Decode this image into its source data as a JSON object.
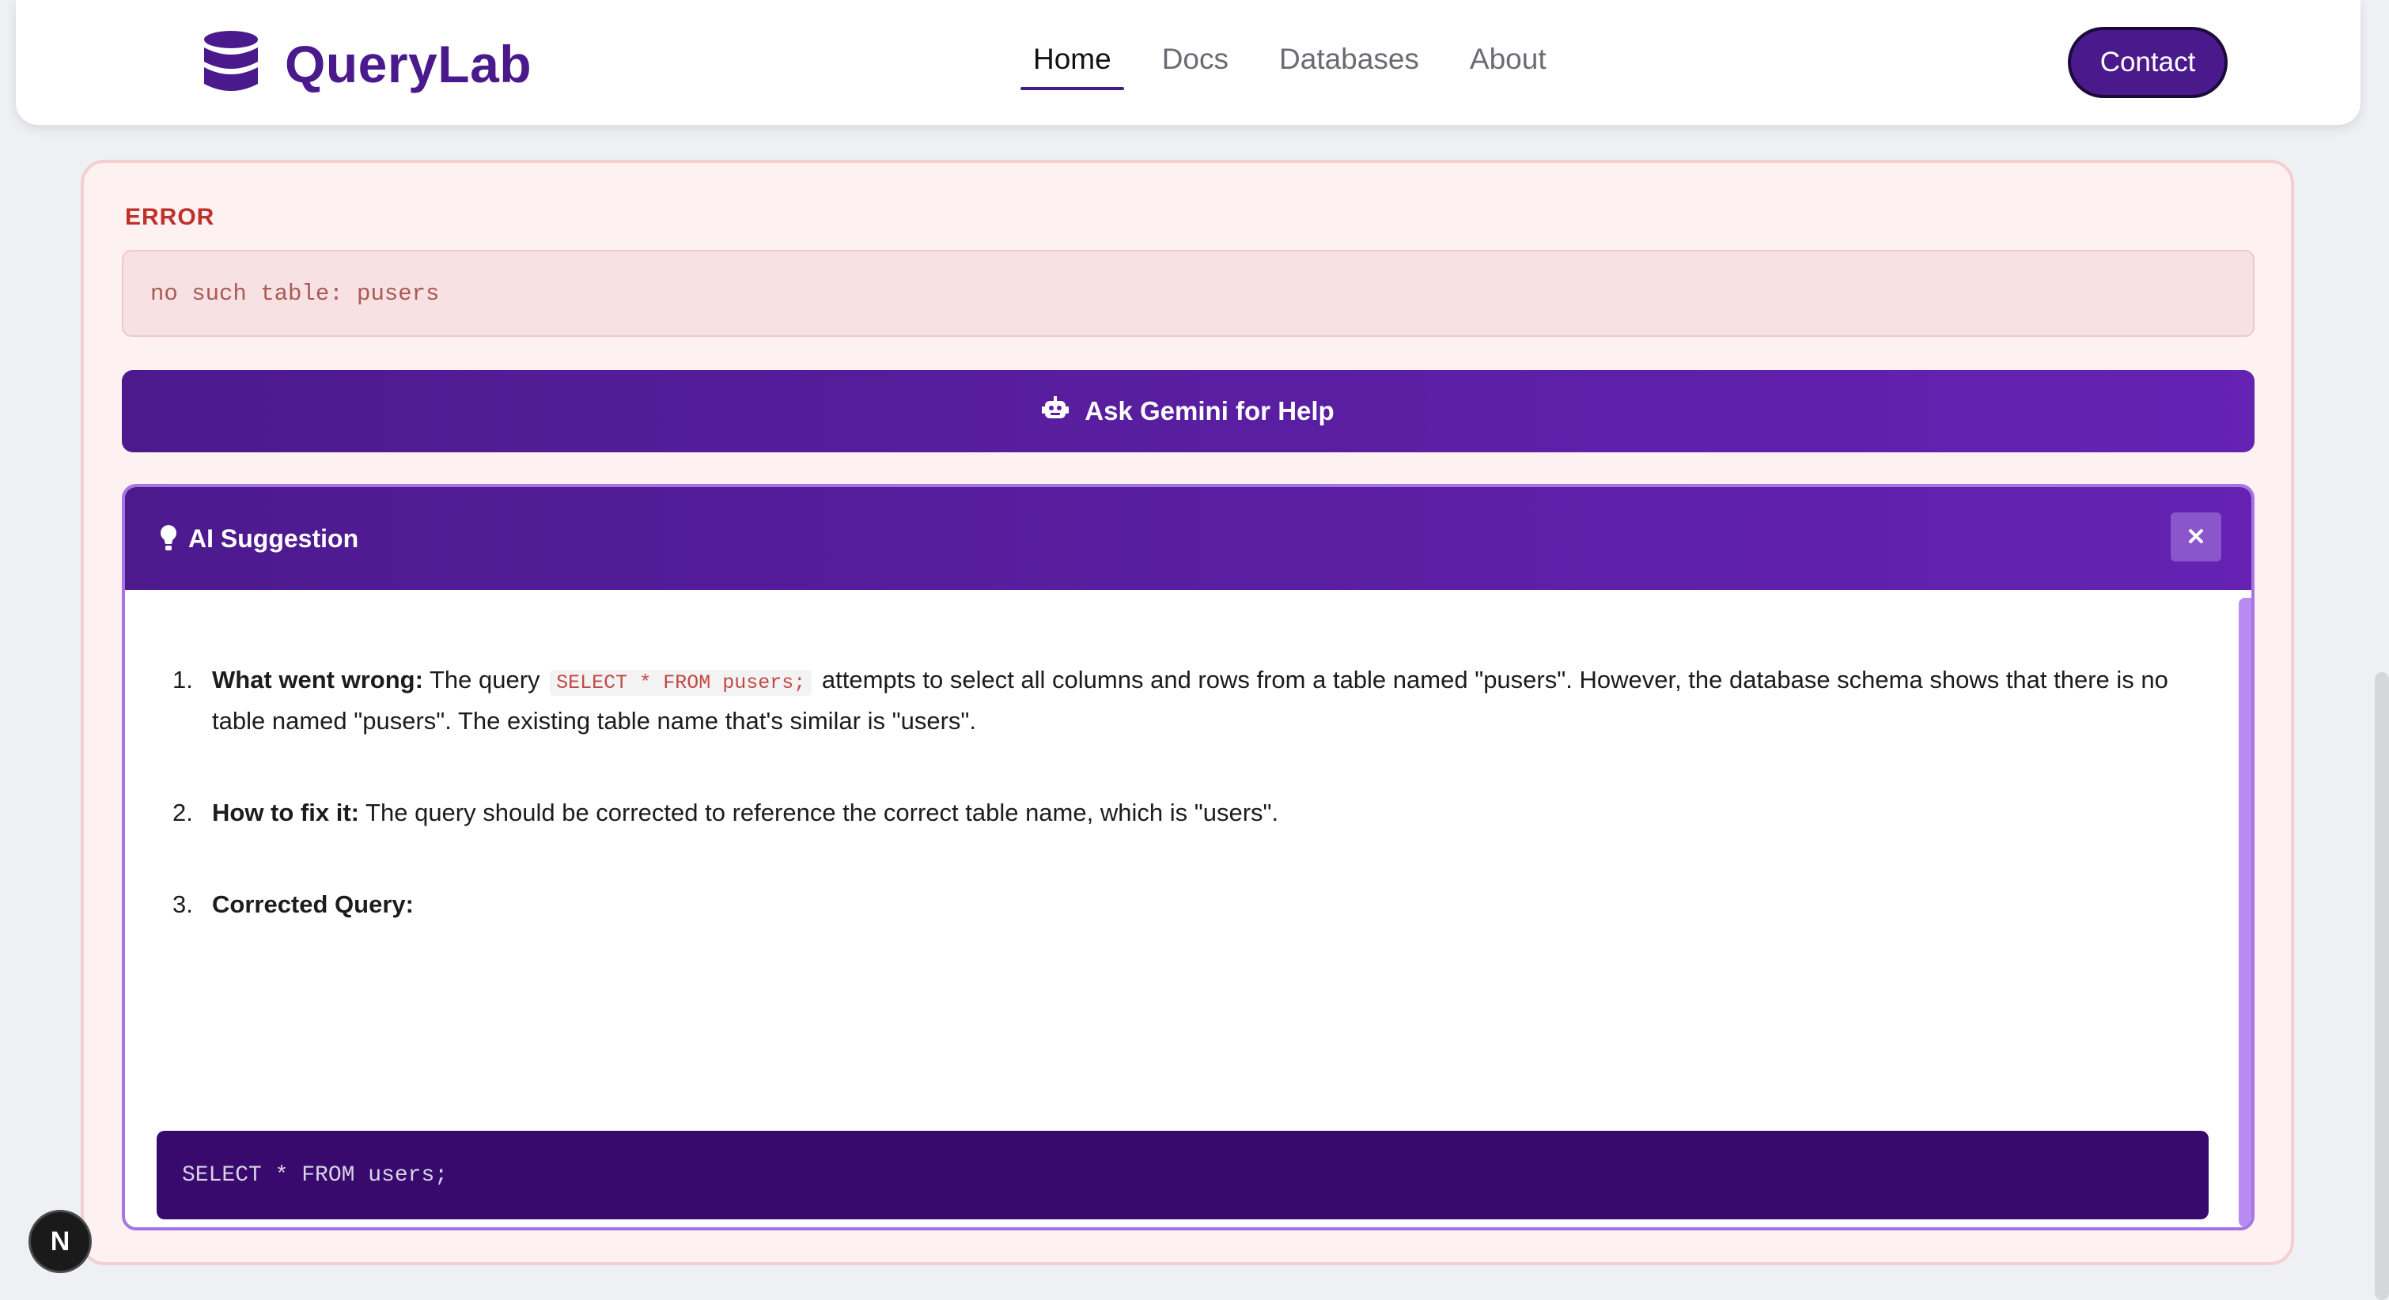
{
  "header": {
    "brand": "QueryLab",
    "nav": [
      {
        "label": "Home",
        "active": true
      },
      {
        "label": "Docs",
        "active": false
      },
      {
        "label": "Databases",
        "active": false
      },
      {
        "label": "About",
        "active": false
      }
    ],
    "contact_label": "Contact"
  },
  "error": {
    "label": "ERROR",
    "message": "no such table: pusers"
  },
  "ask_button": {
    "label": "Ask Gemini for Help",
    "icon": "robot-icon"
  },
  "suggestion": {
    "title": "AI Suggestion",
    "title_icon": "lightbulb-icon",
    "close_icon": "close-icon",
    "steps": [
      {
        "num": "1.",
        "heading": "What went wrong:",
        "text_before": "The query",
        "code": "SELECT * FROM pusers;",
        "text_after": "attempts to select all columns and rows from a table named \"pusers\". However, the database schema shows that there is no table named \"pusers\". The existing table name that's similar is \"users\"."
      },
      {
        "num": "2.",
        "heading": "How to fix it:",
        "text": "The query should be corrected to reference the correct table name, which is \"users\"."
      },
      {
        "num": "3.",
        "heading": "Corrected Query:"
      }
    ],
    "corrected_query": "SELECT * FROM users;"
  },
  "dev_badge": "N",
  "colors": {
    "brand_purple": "#4a1a8c",
    "error_red": "#c0302b",
    "code_bg": "#390a6e"
  }
}
